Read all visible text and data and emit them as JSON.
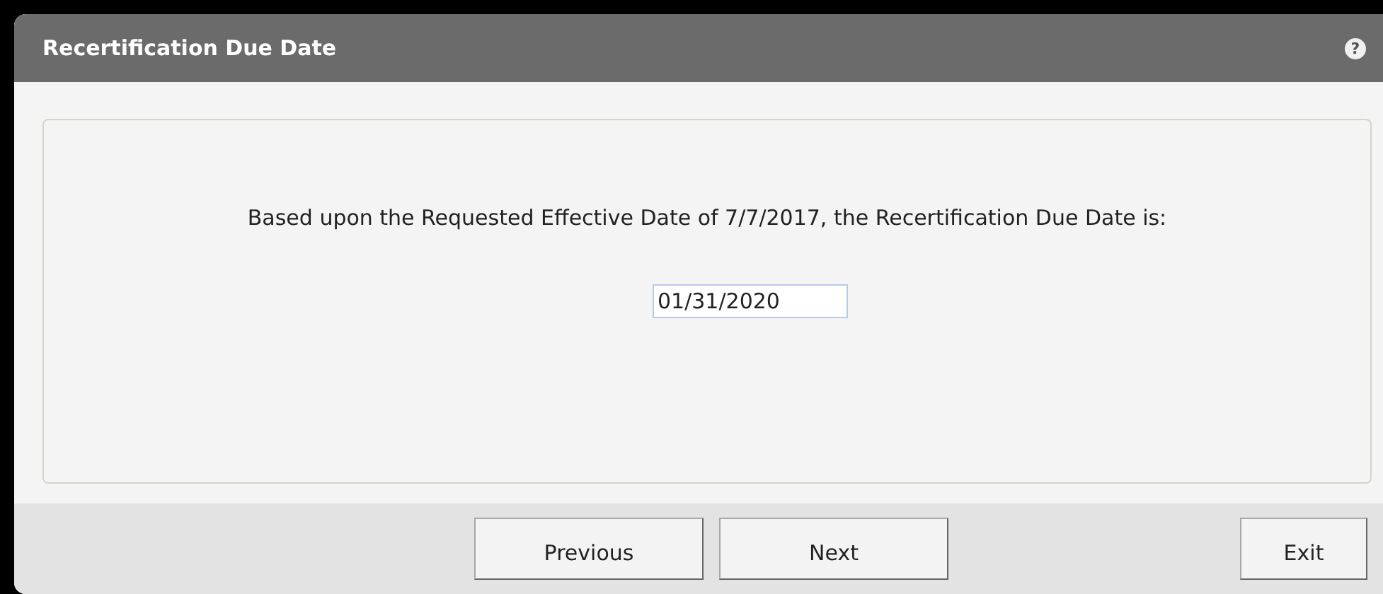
{
  "dialog": {
    "title": "Recertification Due Date",
    "help_icon": "?",
    "message": "Based upon the Requested Effective Date of  7/7/2017, the Recertification Due Date is:",
    "due_date_field": {
      "value": "01/31/2020"
    },
    "buttons": [
      {
        "label": "Previous",
        "kind": "nav"
      },
      {
        "label": "Next",
        "kind": "nav"
      },
      {
        "label": "Exit",
        "kind": "exit"
      }
    ]
  }
}
